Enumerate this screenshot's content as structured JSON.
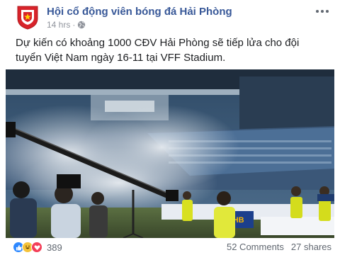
{
  "post": {
    "page_name": "Hội cổ động viên bóng đá Hải Phòng",
    "time": "14 hrs",
    "privacy_icon": "globe-icon",
    "text": "Dự kiến có khoảng 1000 CĐV Hải Phòng sẽ tiếp lửa cho đội tuyển Việt Nam ngày 16-11 tại VFF Stadium."
  },
  "photo": {
    "description_icons": [
      "stadium-photo"
    ],
    "board_text": "SHB"
  },
  "footer": {
    "reaction_count": "389",
    "reactions": [
      "like-icon",
      "haha-icon",
      "love-icon"
    ],
    "comments": "52 Comments",
    "shares": "27 shares"
  },
  "colors": {
    "link_blue": "#385898",
    "like_blue": "#2d88ff",
    "love_red": "#f33e58"
  }
}
